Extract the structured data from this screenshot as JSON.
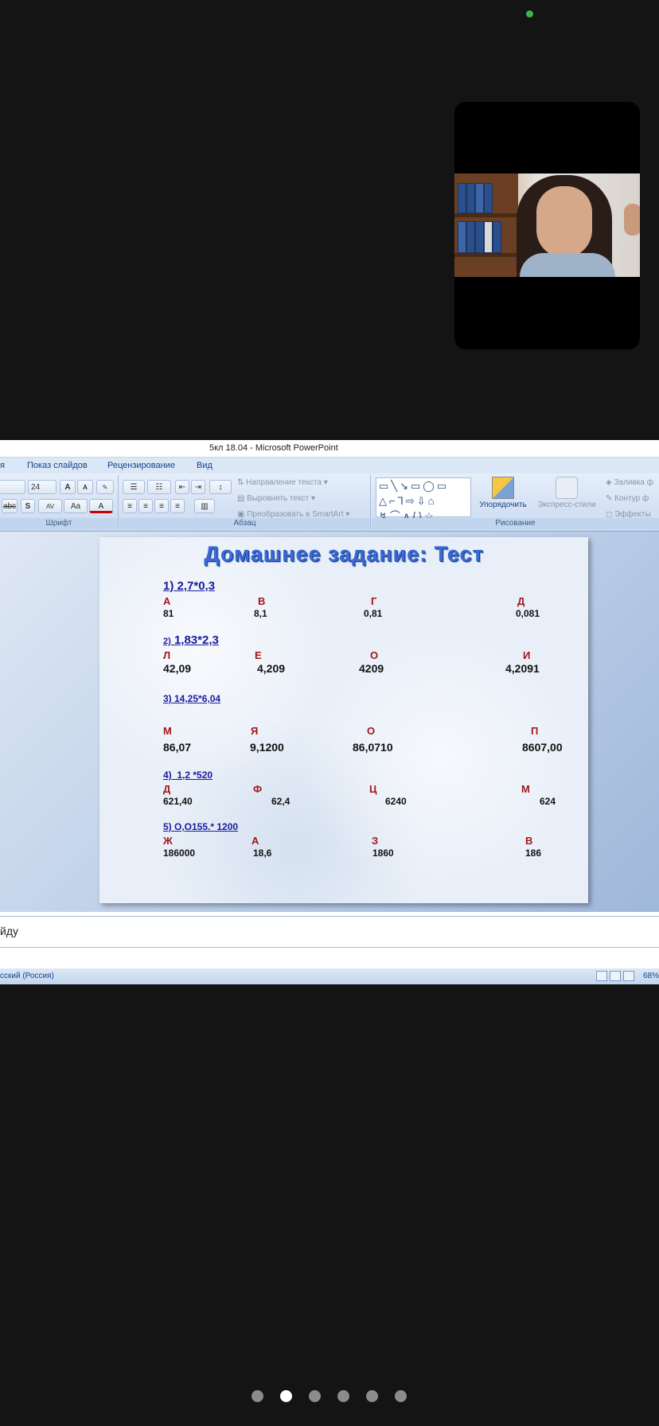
{
  "window_title": "5кл 18.04 - Microsoft PowerPoint",
  "ribbon_tabs": [
    "я",
    "Показ слайдов",
    "Рецензирование",
    "Вид"
  ],
  "ribbon": {
    "font_size": "24",
    "font_group_label": "Шрифт",
    "paragraph_group_label": "Абзац",
    "drawing_group_label": "Рисование",
    "text_direction": "Направление текста",
    "align_text": "Выровнять текст",
    "convert_smartart": "Преобразовать в SmartArt",
    "arrange": "Упорядочить",
    "quick_styles": "Экспресс-стили",
    "shape_fill": "Заливка ф",
    "shape_outline": "Контур ф",
    "shape_effects": "Эффекты"
  },
  "slide": {
    "title": "Домашнее задание: Тест",
    "questions": [
      {
        "label_prefix": "",
        "label": "1) 2,7*0,3",
        "options": [
          {
            "letter": "А",
            "value": "81"
          },
          {
            "letter": "В",
            "value": "8,1"
          },
          {
            "letter": "Г",
            "value": "0,81"
          },
          {
            "letter": "Д",
            "value": "0,081"
          }
        ]
      },
      {
        "label_prefix": "2)",
        "label": "1,83*2,3",
        "options": [
          {
            "letter": "Л",
            "value": "42,09"
          },
          {
            "letter": "Е",
            "value": "4,209"
          },
          {
            "letter": "О",
            "value": "4209"
          },
          {
            "letter": "И",
            "value": "4,2091"
          }
        ]
      },
      {
        "label_prefix": "",
        "label": "3) 14,25*6,04",
        "options": [
          {
            "letter": "М",
            "value": "86,07"
          },
          {
            "letter": "Я",
            "value": "9,1200"
          },
          {
            "letter": "О",
            "value": "86,0710"
          },
          {
            "letter": "П",
            "value": "8607,00"
          }
        ]
      },
      {
        "label_prefix": "",
        "label": "4)  1,2 *520",
        "options": [
          {
            "letter": "Д",
            "value": "621,40"
          },
          {
            "letter": "Ф",
            "value": "62,4"
          },
          {
            "letter": "Ц",
            "value": "6240"
          },
          {
            "letter": "М",
            "value": "624"
          }
        ]
      },
      {
        "label_prefix": "",
        "label": "5) О,О155.* 1200",
        "options": [
          {
            "letter": "Ж",
            "value": "186000"
          },
          {
            "letter": "А",
            "value": "18,6"
          },
          {
            "letter": "З",
            "value": "1860"
          },
          {
            "letter": "В",
            "value": "186"
          }
        ]
      }
    ]
  },
  "notes_text": "йду",
  "status": {
    "language": "сский (Россия)",
    "zoom": "68%"
  },
  "pagination": {
    "total": 6,
    "active_index": 1
  },
  "colors": {
    "accent": "#3fb34f",
    "title_blue": "#3a6ad2",
    "letter_red": "#a3161a"
  }
}
